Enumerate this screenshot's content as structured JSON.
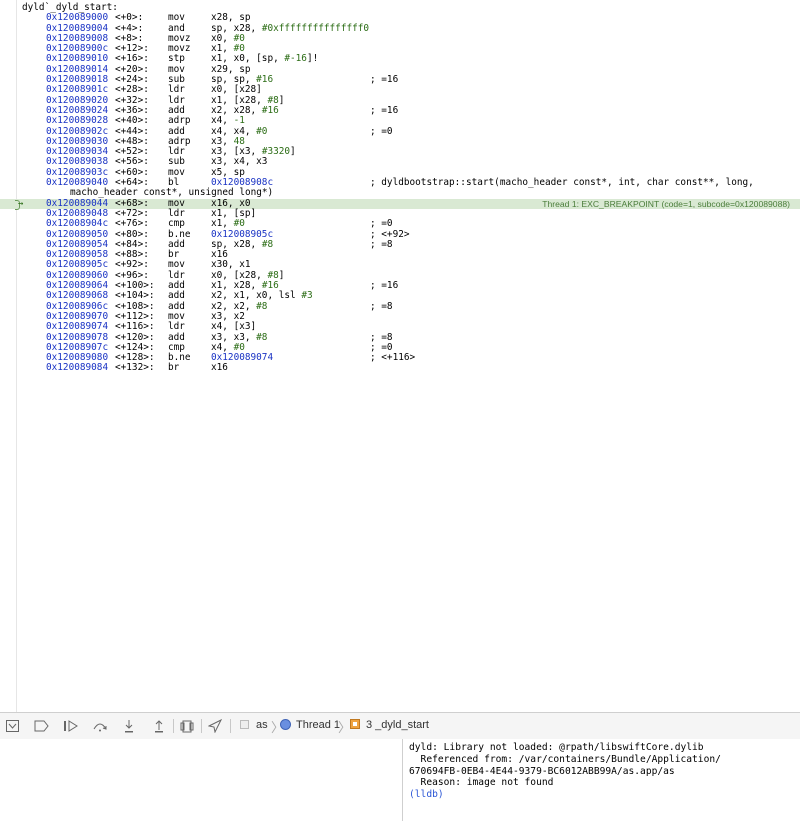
{
  "disassembly": {
    "function_header": "dyld`_dyld_start:",
    "lines": [
      {
        "addr": "0x120089000",
        "off": "<+0>:",
        "mn": "mov",
        "ops": "x28, sp",
        "cm": ""
      },
      {
        "addr": "0x120089004",
        "off": "<+4>:",
        "mn": "and",
        "ops": "sp, x28, ",
        "imm": "#0xfffffffffffffff0",
        "cm": ""
      },
      {
        "addr": "0x120089008",
        "off": "<+8>:",
        "mn": "movz",
        "ops": "x0, ",
        "imm": "#0",
        "cm": ""
      },
      {
        "addr": "0x12008900c",
        "off": "<+12>:",
        "mn": "movz",
        "ops": "x1, ",
        "imm": "#0",
        "cm": ""
      },
      {
        "addr": "0x120089010",
        "off": "<+16>:",
        "mn": "stp",
        "ops": "x1, x0, [sp, ",
        "imm": "#-16",
        "ops2": "]!",
        "cm": ""
      },
      {
        "addr": "0x120089014",
        "off": "<+20>:",
        "mn": "mov",
        "ops": "x29, sp",
        "cm": ""
      },
      {
        "addr": "0x120089018",
        "off": "<+24>:",
        "mn": "sub",
        "ops": "sp, sp, ",
        "imm": "#16",
        "cm": "; =16"
      },
      {
        "addr": "0x12008901c",
        "off": "<+28>:",
        "mn": "ldr",
        "ops": "x0, [x28]",
        "cm": ""
      },
      {
        "addr": "0x120089020",
        "off": "<+32>:",
        "mn": "ldr",
        "ops": "x1, [x28, ",
        "imm": "#8",
        "ops2": "]",
        "cm": ""
      },
      {
        "addr": "0x120089024",
        "off": "<+36>:",
        "mn": "add",
        "ops": "x2, x28, ",
        "imm": "#16",
        "cm": "; =16"
      },
      {
        "addr": "0x120089028",
        "off": "<+40>:",
        "mn": "adrp",
        "ops": "x4, ",
        "imm": "-1",
        "cm": ""
      },
      {
        "addr": "0x12008902c",
        "off": "<+44>:",
        "mn": "add",
        "ops": "x4, x4, ",
        "imm": "#0",
        "cm": "; =0"
      },
      {
        "addr": "0x120089030",
        "off": "<+48>:",
        "mn": "adrp",
        "ops": "x3, ",
        "imm": "48",
        "cm": ""
      },
      {
        "addr": "0x120089034",
        "off": "<+52>:",
        "mn": "ldr",
        "ops": "x3, [x3, ",
        "imm": "#3320",
        "ops2": "]",
        "cm": ""
      },
      {
        "addr": "0x120089038",
        "off": "<+56>:",
        "mn": "sub",
        "ops": "x3, x4, x3",
        "cm": ""
      },
      {
        "addr": "0x12008903c",
        "off": "<+60>:",
        "mn": "mov",
        "ops": "x5, sp",
        "cm": ""
      },
      {
        "addr": "0x120089040",
        "off": "<+64>:",
        "mn": "bl",
        "tgt": "0x12008908c",
        "ops": "",
        "cm": "; dyldbootstrap::start(macho_header const*, int, char const**, long,"
      },
      {
        "continuation": "macho_header const*, unsigned long*)"
      },
      {
        "addr": "0x120089044",
        "off": "<+68>:",
        "mn": "mov",
        "ops": "x16, x0",
        "cm": "",
        "current": true
      },
      {
        "addr": "0x120089048",
        "off": "<+72>:",
        "mn": "ldr",
        "ops": "x1, [sp]",
        "cm": ""
      },
      {
        "addr": "0x12008904c",
        "off": "<+76>:",
        "mn": "cmp",
        "ops": "x1, ",
        "imm": "#0",
        "cm": "; =0"
      },
      {
        "addr": "0x120089050",
        "off": "<+80>:",
        "mn": "b.ne",
        "tgt": "0x12008905c",
        "ops": "",
        "cm": "; <+92>"
      },
      {
        "addr": "0x120089054",
        "off": "<+84>:",
        "mn": "add",
        "ops": "sp, x28, ",
        "imm": "#8",
        "cm": "; =8"
      },
      {
        "addr": "0x120089058",
        "off": "<+88>:",
        "mn": "br",
        "ops": "x16",
        "cm": ""
      },
      {
        "addr": "0x12008905c",
        "off": "<+92>:",
        "mn": "mov",
        "ops": "x30, x1",
        "cm": ""
      },
      {
        "addr": "0x120089060",
        "off": "<+96>:",
        "mn": "ldr",
        "ops": "x0, [x28, ",
        "imm": "#8",
        "ops2": "]",
        "cm": ""
      },
      {
        "addr": "0x120089064",
        "off": "<+100>:",
        "mn": "add",
        "ops": "x1, x28, ",
        "imm": "#16",
        "cm": "; =16"
      },
      {
        "addr": "0x120089068",
        "off": "<+104>:",
        "mn": "add",
        "ops": "x2, x1, x0, lsl ",
        "imm": "#3",
        "cm": ""
      },
      {
        "addr": "0x12008906c",
        "off": "<+108>:",
        "mn": "add",
        "ops": "x2, x2, ",
        "imm": "#8",
        "cm": "; =8"
      },
      {
        "addr": "0x120089070",
        "off": "<+112>:",
        "mn": "mov",
        "ops": "x3, x2",
        "cm": ""
      },
      {
        "addr": "0x120089074",
        "off": "<+116>:",
        "mn": "ldr",
        "ops": "x4, [x3]",
        "cm": ""
      },
      {
        "addr": "0x120089078",
        "off": "<+120>:",
        "mn": "add",
        "ops": "x3, x3, ",
        "imm": "#8",
        "cm": "; =8"
      },
      {
        "addr": "0x12008907c",
        "off": "<+124>:",
        "mn": "cmp",
        "ops": "x4, ",
        "imm": "#0",
        "cm": "; =0"
      },
      {
        "addr": "0x120089080",
        "off": "<+128>:",
        "mn": "b.ne",
        "tgt": "0x120089074",
        "ops": "",
        "cm": "; <+116>"
      },
      {
        "addr": "0x120089084",
        "off": "<+132>:",
        "mn": "br",
        "ops": "x16",
        "cm": ""
      }
    ],
    "thread_badge": "Thread 1: EXC_BREAKPOINT (code=1, subcode=0x120089088)"
  },
  "debug_bar": {
    "process": "as",
    "thread": "Thread 1",
    "frame": "3 _dyld_start"
  },
  "console": {
    "lines": [
      "dyld: Library not loaded: @rpath/libswiftCore.dylib",
      "  Referenced from: /var/containers/Bundle/Application/",
      "670694FB-0EB4-4E44-9379-BC6012ABB99A/as.app/as",
      "  Reason: image not found"
    ],
    "prompt": "(lldb)"
  }
}
